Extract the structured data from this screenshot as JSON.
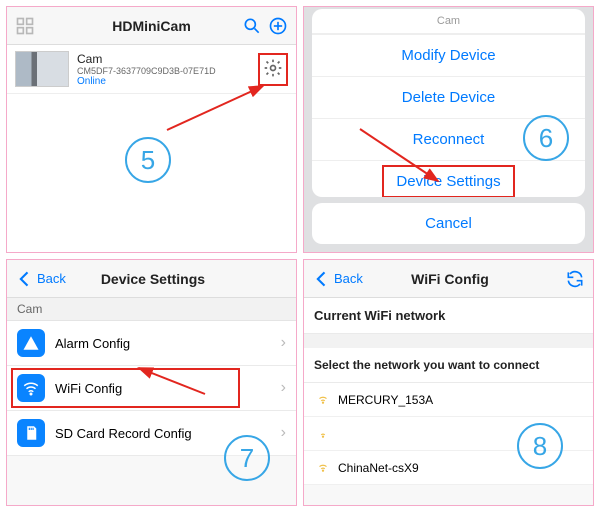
{
  "panel5": {
    "title": "HDMiniCam",
    "device": {
      "name": "Cam",
      "id": "CM5DF7-3637709C9D3B-07E71D",
      "status": "Online"
    },
    "step": "5"
  },
  "panel6": {
    "sheetTitle": "Cam",
    "items": [
      "Modify Device",
      "Delete Device",
      "Reconnect",
      "Device Settings"
    ],
    "cancel": "Cancel",
    "step": "6"
  },
  "panel7": {
    "back": "Back",
    "title": "Device Settings",
    "section": "Cam",
    "rows": [
      "Alarm Config",
      "WiFi Config",
      "SD Card Record Config"
    ],
    "step": "7"
  },
  "panel8": {
    "back": "Back",
    "title": "WiFi Config",
    "currentLabel": "Current WiFi network",
    "selectLabel": "Select the network you want to connect",
    "networks": [
      "MERCURY_153A",
      "",
      "ChinaNet-csX9"
    ],
    "step": "8"
  }
}
